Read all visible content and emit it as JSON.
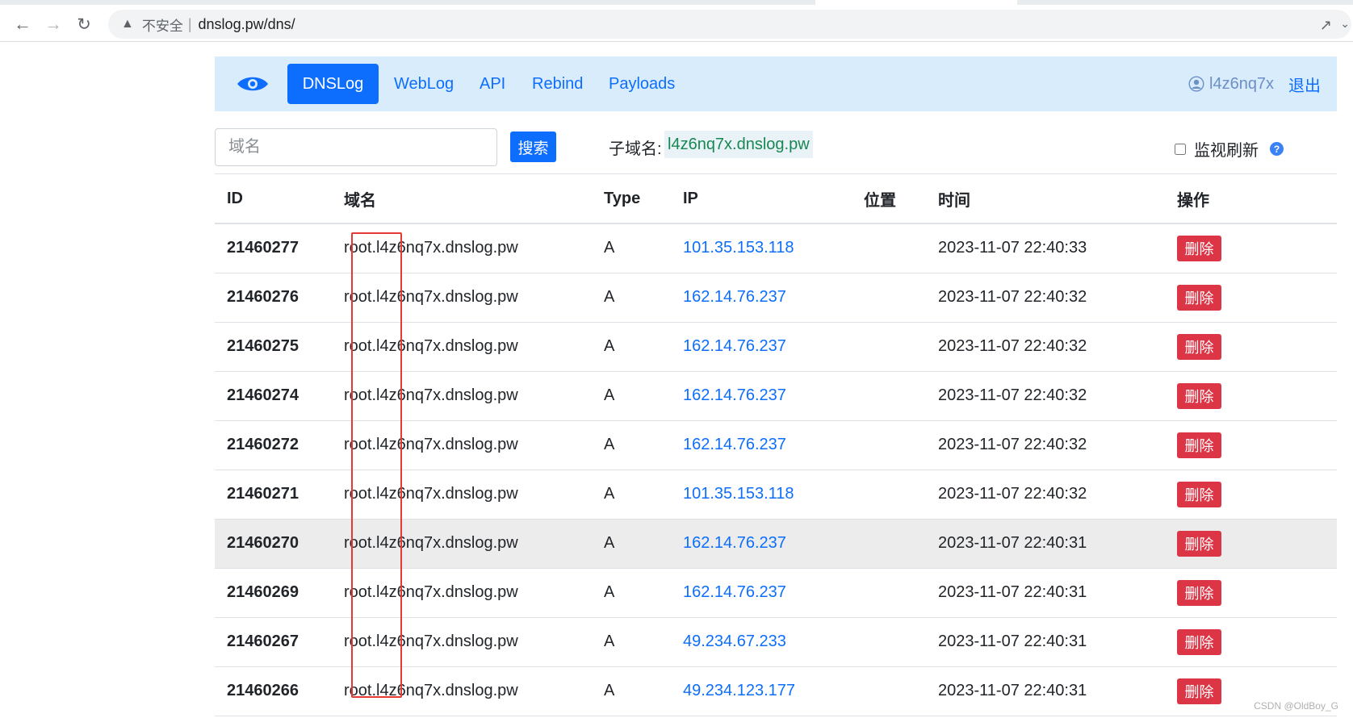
{
  "browser": {
    "back_icon": "arrow-left-icon",
    "forward_icon": "arrow-right-icon",
    "reload_icon": "reload-icon",
    "security_text": "不安全",
    "url": "dnslog.pw/dns/"
  },
  "navbar": {
    "logo_icon": "eye-icon",
    "items": [
      {
        "label": "DNSLog",
        "active": true
      },
      {
        "label": "WebLog"
      },
      {
        "label": "API"
      },
      {
        "label": "Rebind"
      },
      {
        "label": "Payloads"
      }
    ],
    "username": "l4z6nq7x",
    "logout": "退出"
  },
  "search": {
    "placeholder": "域名",
    "button": "搜索",
    "subdomain_label": "子域名:",
    "subdomain_value": "l4z6nq7x.dnslog.pw",
    "monitor_label": "监视刷新",
    "help": "?"
  },
  "table": {
    "headers": [
      "ID",
      "域名",
      "Type",
      "IP",
      "位置",
      "时间",
      "操作"
    ],
    "delete_label": "删除",
    "rows": [
      {
        "id": "21460277",
        "domain": "root.l4z6nq7x.dnslog.pw",
        "type": "A",
        "ip": "101.35.153.118",
        "location": "",
        "time": "2023-11-07 22:40:33"
      },
      {
        "id": "21460276",
        "domain": "root.l4z6nq7x.dnslog.pw",
        "type": "A",
        "ip": "162.14.76.237",
        "location": "",
        "time": "2023-11-07 22:40:32"
      },
      {
        "id": "21460275",
        "domain": "root.l4z6nq7x.dnslog.pw",
        "type": "A",
        "ip": "162.14.76.237",
        "location": "",
        "time": "2023-11-07 22:40:32"
      },
      {
        "id": "21460274",
        "domain": "root.l4z6nq7x.dnslog.pw",
        "type": "A",
        "ip": "162.14.76.237",
        "location": "",
        "time": "2023-11-07 22:40:32"
      },
      {
        "id": "21460272",
        "domain": "root.l4z6nq7x.dnslog.pw",
        "type": "A",
        "ip": "162.14.76.237",
        "location": "",
        "time": "2023-11-07 22:40:32"
      },
      {
        "id": "21460271",
        "domain": "root.l4z6nq7x.dnslog.pw",
        "type": "A",
        "ip": "101.35.153.118",
        "location": "",
        "time": "2023-11-07 22:40:32"
      },
      {
        "id": "21460270",
        "domain": "root.l4z6nq7x.dnslog.pw",
        "type": "A",
        "ip": "162.14.76.237",
        "location": "",
        "time": "2023-11-07 22:40:31"
      },
      {
        "id": "21460269",
        "domain": "root.l4z6nq7x.dnslog.pw",
        "type": "A",
        "ip": "162.14.76.237",
        "location": "",
        "time": "2023-11-07 22:40:31"
      },
      {
        "id": "21460267",
        "domain": "root.l4z6nq7x.dnslog.pw",
        "type": "A",
        "ip": "49.234.67.233",
        "location": "",
        "time": "2023-11-07 22:40:31"
      },
      {
        "id": "21460266",
        "domain": "root.l4z6nq7x.dnslog.pw",
        "type": "A",
        "ip": "49.234.123.177",
        "location": "",
        "time": "2023-11-07 22:40:31"
      }
    ]
  },
  "watermark": "CSDN @OldBoy_G",
  "colors": {
    "primary": "#0d6efd",
    "navbar_bg": "#d9ecfb",
    "danger": "#dc3545",
    "subdomain_text": "#198754",
    "annotation": "#e53935"
  }
}
